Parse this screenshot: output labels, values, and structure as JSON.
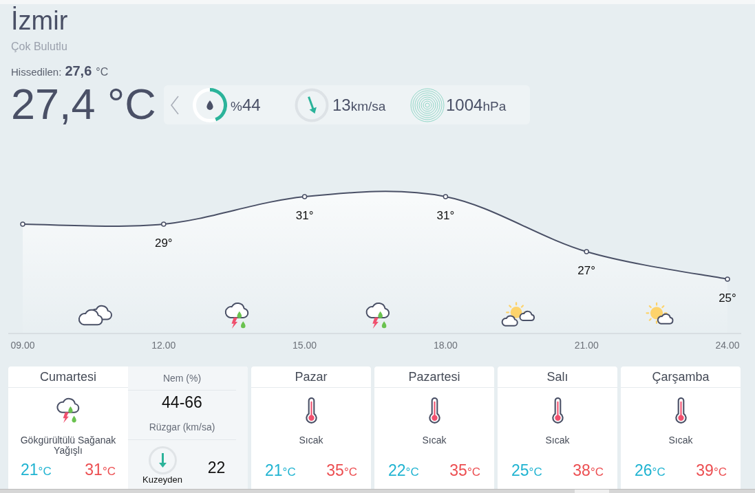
{
  "location": {
    "city": "İzmir",
    "condition": "Çok Bulutlu",
    "feels_like": {
      "label": "Hissedilen:",
      "value": "27,6",
      "unit": "°C"
    },
    "temperature": "27,4 °C"
  },
  "stats": {
    "humidity": {
      "prefix": "%",
      "value": "44",
      "level": 0.44
    },
    "wind": {
      "value": "13",
      "unit": "km/sa"
    },
    "pressure": {
      "value": "1004",
      "unit": "hPa"
    }
  },
  "hourly": {
    "chart_data": {
      "type": "area",
      "marker": true,
      "categories": [
        "09.00",
        "12.00",
        "15.00",
        "18.00",
        "21.00",
        "24.00"
      ],
      "values": [
        29,
        29,
        31,
        31,
        27,
        25
      ],
      "value_labels": [
        null,
        "29°",
        "31°",
        "31°",
        "27°",
        "25°"
      ]
    },
    "icons": [
      {
        "kind": "cloudy"
      },
      {
        "kind": "storm"
      },
      {
        "kind": "storm"
      },
      {
        "kind": "partly-cloudy"
      },
      {
        "kind": "mostly-sunny"
      }
    ]
  },
  "today": {
    "day": "Cumartesi",
    "kind": "storm",
    "condition": "Gökgürültülü Sağanak Yağışlı",
    "low": {
      "value": "21",
      "unit": "°C"
    },
    "high": {
      "value": "31",
      "unit": "°C"
    },
    "humidity": {
      "label": "Nem (%)",
      "value": "44-66"
    },
    "wind": {
      "label": "Rüzgar (km/sa)",
      "direction": "Kuzeyden",
      "speed": "22"
    }
  },
  "forecast": [
    {
      "day": "Pazar",
      "kind": "hot",
      "condition": "Sıcak",
      "low": {
        "value": "21",
        "unit": "°C"
      },
      "high": {
        "value": "35",
        "unit": "°C"
      }
    },
    {
      "day": "Pazartesi",
      "kind": "hot",
      "condition": "Sıcak",
      "low": {
        "value": "22",
        "unit": "°C"
      },
      "high": {
        "value": "35",
        "unit": "°C"
      }
    },
    {
      "day": "Salı",
      "kind": "hot",
      "condition": "Sıcak",
      "low": {
        "value": "25",
        "unit": "°C"
      },
      "high": {
        "value": "38",
        "unit": "°C"
      }
    },
    {
      "day": "Çarşamba",
      "kind": "hot",
      "condition": "Sıcak",
      "low": {
        "value": "26",
        "unit": "°C"
      },
      "high": {
        "value": "39",
        "unit": "°C"
      }
    }
  ]
}
